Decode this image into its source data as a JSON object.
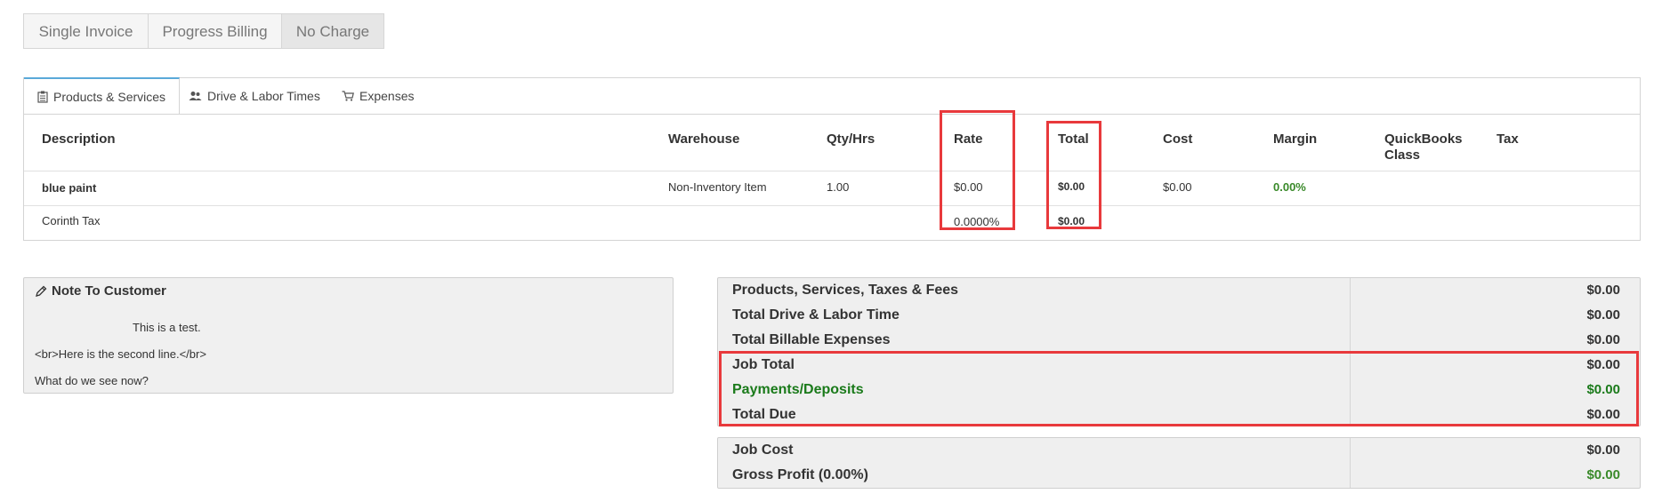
{
  "billing_types": [
    "Single Invoice",
    "Progress Billing",
    "No Charge"
  ],
  "tabs": {
    "products": "Products & Services",
    "labor": "Drive & Labor Times",
    "expenses": "Expenses"
  },
  "columns": {
    "description": "Description",
    "warehouse": "Warehouse",
    "qty": "Qty/Hrs",
    "rate": "Rate",
    "total": "Total",
    "cost": "Cost",
    "margin": "Margin",
    "qb_class_1": "QuickBooks",
    "qb_class_2": "Class",
    "tax": "Tax"
  },
  "rows": [
    {
      "description": "blue paint",
      "warehouse": "Non-Inventory Item",
      "qty": "1.00",
      "rate": "$0.00",
      "total": "$0.00",
      "cost": "$0.00",
      "margin": "0.00%"
    },
    {
      "description": "Corinth Tax",
      "rate": "0.0000%",
      "total": "$0.00"
    }
  ],
  "note": {
    "title": "Note To Customer",
    "lines": [
      "This is a test.",
      "<br>Here is the second line.</br>",
      "What do we see now?"
    ]
  },
  "totals": [
    {
      "label": "Products, Services, Taxes & Fees",
      "value": "$0.00"
    },
    {
      "label": "Total Drive & Labor Time",
      "value": "$0.00"
    },
    {
      "label": "Total Billable Expenses",
      "value": "$0.00"
    },
    {
      "label": "Job Total",
      "value": "$0.00"
    },
    {
      "label": "Payments/Deposits",
      "value": "$0.00"
    },
    {
      "label": "Total Due",
      "value": "$0.00"
    }
  ],
  "cost_totals": [
    {
      "label": "Job Cost",
      "value": "$0.00"
    },
    {
      "label": "Gross Profit (0.00%)",
      "value": "$0.00"
    }
  ],
  "colors": {
    "highlight": "#e8393c",
    "green": "#1a7a1a",
    "tab_accent": "#5aa9d9"
  }
}
